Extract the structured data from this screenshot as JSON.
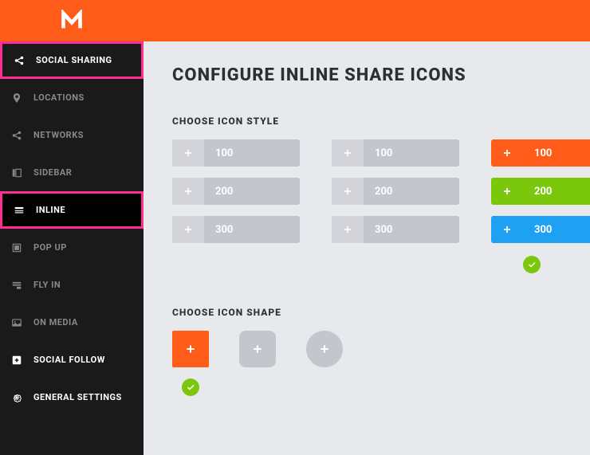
{
  "sidebar": {
    "items": [
      {
        "label": "SOCIAL SHARING",
        "icon": "share"
      },
      {
        "label": "LOCATIONS",
        "icon": "pin"
      },
      {
        "label": "NETWORKS",
        "icon": "share"
      },
      {
        "label": "SIDEBAR",
        "icon": "sidebar"
      },
      {
        "label": "INLINE",
        "icon": "inline"
      },
      {
        "label": "POP UP",
        "icon": "popup"
      },
      {
        "label": "FLY IN",
        "icon": "flyin"
      },
      {
        "label": "ON MEDIA",
        "icon": "media"
      },
      {
        "label": "SOCIAL FOLLOW",
        "icon": "follow"
      },
      {
        "label": "GENERAL SETTINGS",
        "icon": "gear"
      }
    ]
  },
  "main": {
    "title": "CONFIGURE INLINE SHARE ICONS",
    "style_section": {
      "title": "CHOOSE ICON STYLE",
      "options": [
        {
          "value": "100",
          "variant": "gray"
        },
        {
          "value": "100",
          "variant": "gray"
        },
        {
          "value": "100",
          "variant": "orange"
        },
        {
          "value": "200",
          "variant": "gray"
        },
        {
          "value": "200",
          "variant": "gray"
        },
        {
          "value": "200",
          "variant": "green"
        },
        {
          "value": "300",
          "variant": "gray"
        },
        {
          "value": "300",
          "variant": "gray"
        },
        {
          "value": "300",
          "variant": "blue"
        }
      ],
      "selected_column": 3
    },
    "shape_section": {
      "title": "CHOOSE ICON SHAPE",
      "selected_index": 0
    }
  },
  "colors": {
    "accent": "#ff5c1a",
    "highlight": "#ff2e93",
    "green": "#7ac70c",
    "blue": "#1ea1f2"
  }
}
